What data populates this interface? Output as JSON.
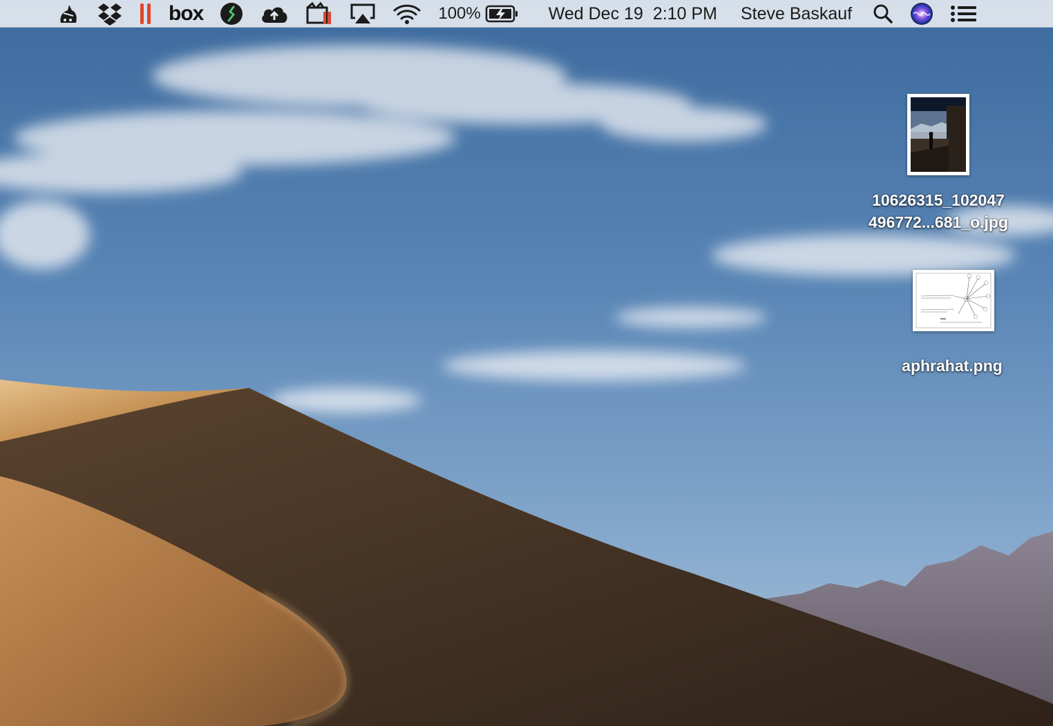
{
  "menubar": {
    "status_items": [
      {
        "name": "alfred-icon"
      },
      {
        "name": "dropbox-icon"
      },
      {
        "name": "parallels-icon"
      },
      {
        "name": "box-icon",
        "label": "box"
      },
      {
        "name": "dollar-app-icon"
      },
      {
        "name": "cloud-upload-icon"
      },
      {
        "name": "screen-recorder-icon"
      },
      {
        "name": "airplay-icon"
      },
      {
        "name": "wifi-icon"
      }
    ],
    "battery_percent": "100%",
    "date": "Wed Dec 19",
    "time": "2:10 PM",
    "user_name": "Steve Baskauf",
    "right_icons": [
      "spotlight-search-icon",
      "siri-icon",
      "notification-center-icon"
    ]
  },
  "desktop": {
    "files": [
      {
        "name_line1": "10626315_102047",
        "name_line2": "496772...681_o.jpg",
        "kind": "photo"
      },
      {
        "name_line1": "aphrahat.png",
        "kind": "document"
      }
    ]
  },
  "colors": {
    "menubar_bg": "#e4e9f0",
    "sky_top": "#3f6d9f",
    "dune_light": "#c99a60",
    "dune_shadow": "#4a3828",
    "mountain": "#7b7382",
    "parallels_red": "#e0452b"
  }
}
